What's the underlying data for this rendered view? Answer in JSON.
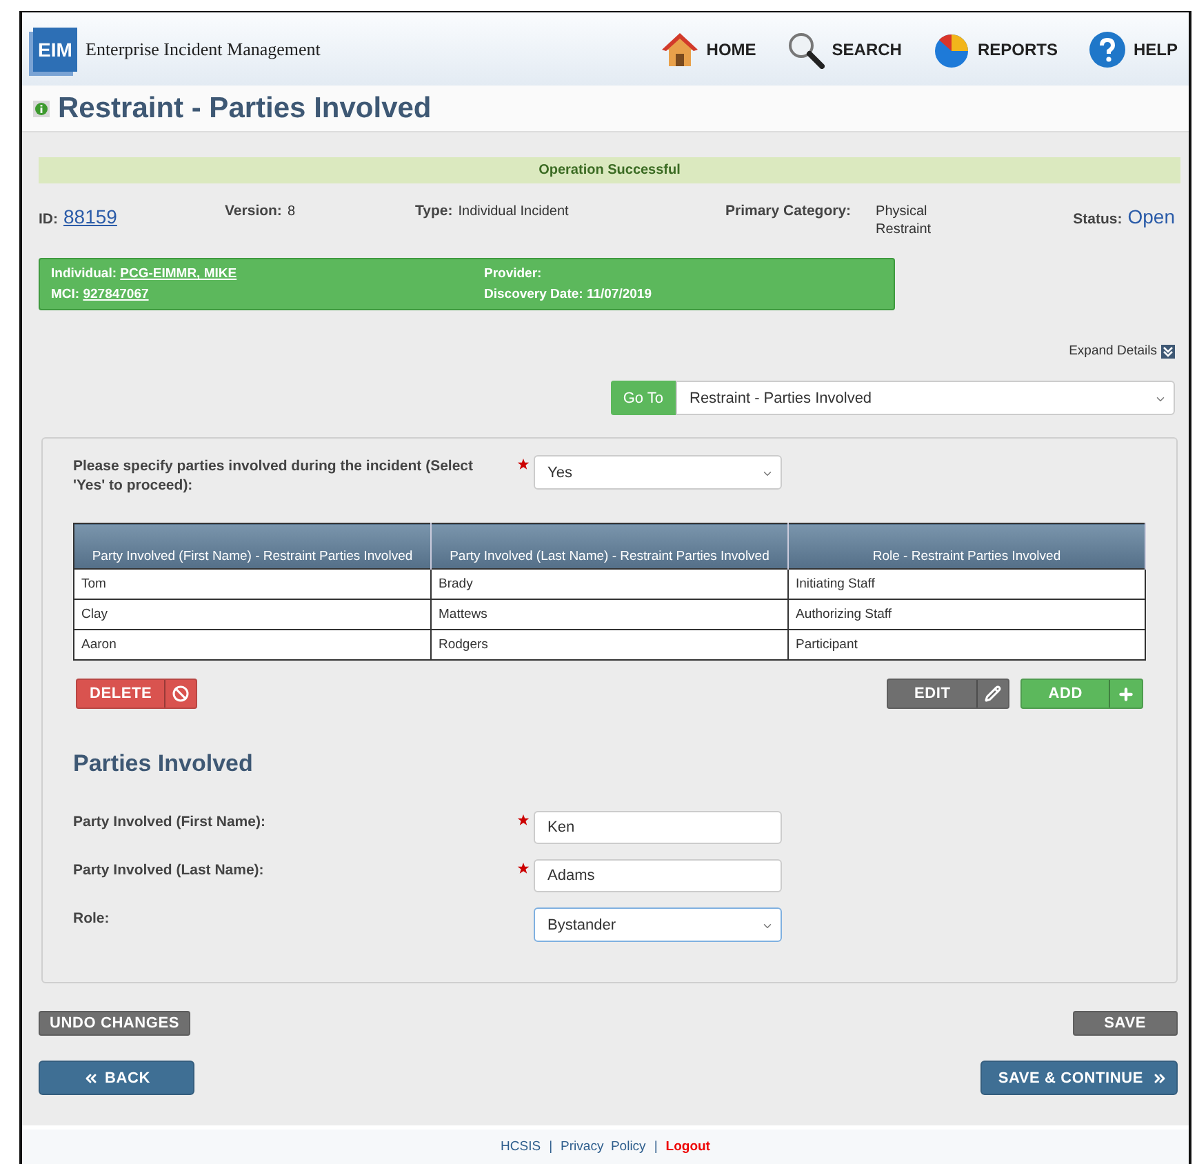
{
  "header": {
    "logo": "EIM",
    "app_name": "Enterprise Incident Management",
    "nav": [
      {
        "kind": "home",
        "label": "HOME"
      },
      {
        "kind": "search",
        "label": "SEARCH"
      },
      {
        "kind": "reports",
        "label": "REPORTS"
      },
      {
        "kind": "help",
        "label": "HELP"
      }
    ]
  },
  "page_title": "Restraint - Parties Involved",
  "message": "Operation Successful",
  "info": {
    "id_label": "ID:",
    "id": "88159",
    "version_label": "Version:",
    "version": "8",
    "type_label": "Type:",
    "type": "Individual Incident",
    "category_label": "Primary Category:",
    "category": "Physical Restraint",
    "status_label": "Status:",
    "status": "Open"
  },
  "summary": {
    "left": [
      {
        "label": "Individual:",
        "value": "PCG-EIMMR, MIKE"
      },
      {
        "label": "MCI:",
        "value": "927847067"
      }
    ],
    "right": [
      {
        "label": "Provider:"
      },
      {
        "label": "Discovery Date:",
        "value": "11/07/2019"
      }
    ]
  },
  "expand_details": "Expand Details",
  "goto": {
    "button": "Go To",
    "value": "Restraint - Parties Involved"
  },
  "question": {
    "label": "Please specify parties involved during the incident (Select 'Yes' to proceed):",
    "required": true,
    "value": "Yes"
  },
  "table": {
    "columns": [
      "Party Involved (First Name) - Restraint Parties Involved",
      "Party Involved (Last Name) - Restraint Parties Involved",
      "Role - Restraint Parties Involved"
    ],
    "rows": [
      [
        "Tom",
        "Brady",
        "Initiating Staff"
      ],
      [
        "Clay",
        "Mattews",
        "Authorizing Staff"
      ],
      [
        "Aaron",
        "Rodgers",
        "Participant"
      ]
    ]
  },
  "table_buttons": {
    "delete": "DELETE",
    "edit": "EDIT",
    "add": "ADD"
  },
  "section_title": "Parties Involved",
  "fields": [
    {
      "kind": "text",
      "label": "Party Involved (First Name):",
      "required": true,
      "value": "Ken",
      "focused": false
    },
    {
      "kind": "text",
      "label": "Party Involved (Last Name):",
      "required": true,
      "value": "Adams",
      "focused": false
    },
    {
      "kind": "select",
      "label": "Role:",
      "required": false,
      "value": "Bystander",
      "focused": true
    }
  ],
  "undo": "UNDO CHANGES",
  "save": "SAVE",
  "back": "BACK",
  "save_continue": "SAVE & CONTINUE",
  "footer": [
    {
      "kind": "link",
      "text": "HCSIS"
    },
    {
      "kind": "separator",
      "text": "|"
    },
    {
      "kind": "link",
      "text": "Privacy  Policy"
    },
    {
      "kind": "separator",
      "text": "|"
    },
    {
      "kind": "logout",
      "text": "Logout"
    }
  ]
}
